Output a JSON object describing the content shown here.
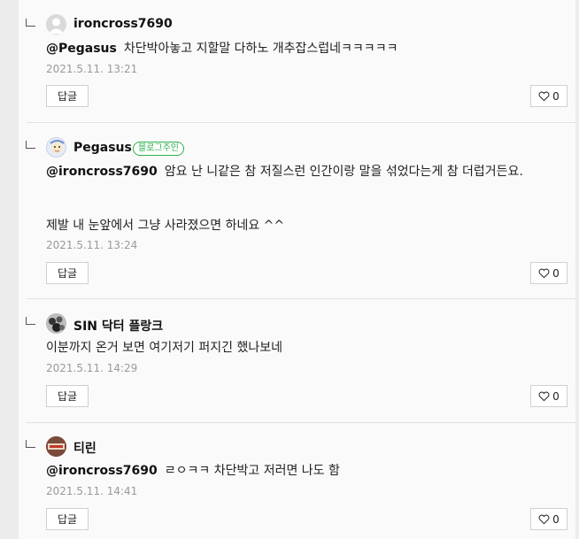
{
  "comments": [
    {
      "author": "ironcross7690",
      "mention": "@Pegasus",
      "text": "차단박아놓고 지할말 다하노 개추잡스럽네ㅋㅋㅋㅋㅋ",
      "date": "2021.5.11. 13:21",
      "reply_label": "답글",
      "likes": "0",
      "avatar_icon": "default-profile-icon"
    },
    {
      "author": "Pegasus",
      "badge": "블로그주인",
      "mention": "@ironcross7690",
      "text": "암요 난 니같은 참 저질스런 인간이랑 말을 섞었다는게 참 더럽거든요.",
      "text2": "제발 내 눈앞에서 그냥 사라졌으면 하네요 ^^",
      "date": "2021.5.11. 13:24",
      "reply_label": "답글",
      "likes": "0",
      "avatar_icon": "pegasus-avatar"
    },
    {
      "author": "SIN 닥터 플랑크",
      "text": "이분까지 온거 보면 여기저기 퍼지긴 했나보네",
      "date": "2021.5.11. 14:29",
      "reply_label": "답글",
      "likes": "0",
      "avatar_icon": "sin-avatar"
    },
    {
      "author": "티린",
      "mention": "@ironcross7690",
      "text": "ㄹㅇㅋㅋ 차단박고 저러면 나도 함",
      "date": "2021.5.11. 14:41",
      "reply_label": "답글",
      "likes": "0",
      "avatar_icon": "tirin-avatar"
    }
  ],
  "colors": {
    "badge": "#2eb14c",
    "date": "#9a9a9a",
    "border": "#d0d0d0"
  }
}
